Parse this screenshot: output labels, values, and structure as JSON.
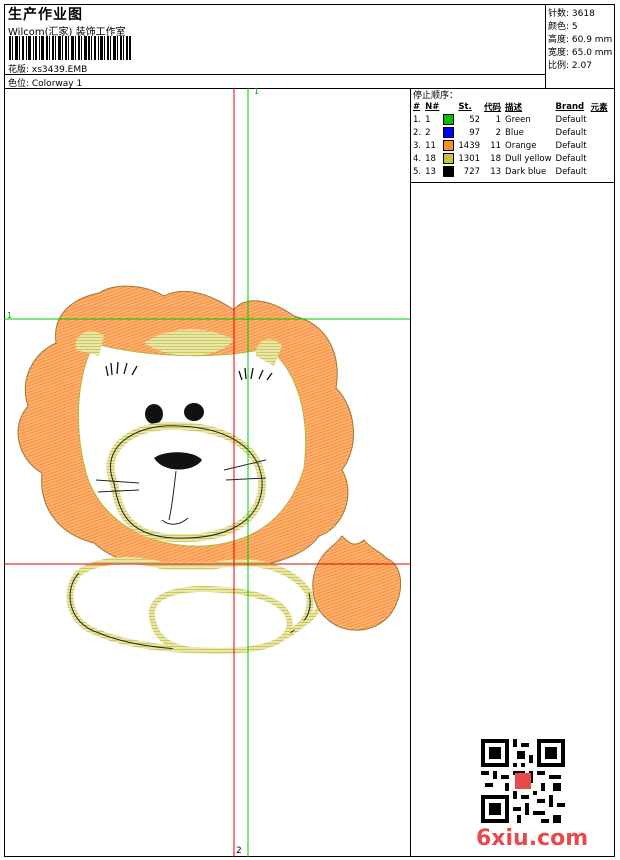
{
  "header": {
    "title": "生产作业图",
    "subtitle": "Wilcom(汇家) 装饰工作室",
    "design_label": "花版: xs3439.EMB",
    "colorway_label": "色位: Colorway 1"
  },
  "stats": {
    "stitches": "针数: 3618",
    "colors": "颜色: 5",
    "height": "高度: 60.9 mm",
    "width": "宽度: 65.0 mm",
    "scale": "比例: 2.07"
  },
  "stop_sequence": {
    "title": "停止顺序：",
    "headers": [
      "#",
      "N#",
      "St.",
      "代码",
      "描述",
      "Brand",
      "元素"
    ],
    "rows": [
      {
        "idx": "1.",
        "n": "1",
        "color": "#00c000",
        "st": "52",
        "code": "1",
        "desc": "Green",
        "brand": "Default"
      },
      {
        "idx": "2.",
        "n": "2",
        "color": "#0000ff",
        "st": "97",
        "code": "2",
        "desc": "Blue",
        "brand": "Default"
      },
      {
        "idx": "3.",
        "n": "11",
        "color": "#ff8c2a",
        "st": "1439",
        "code": "11",
        "desc": "Orange",
        "brand": "Default"
      },
      {
        "idx": "4.",
        "n": "18",
        "color": "#c9c23a",
        "st": "1301",
        "code": "18",
        "desc": "Dull yellow",
        "brand": "Default"
      },
      {
        "idx": "5.",
        "n": "13",
        "color": "#000000",
        "st": "727",
        "code": "13",
        "desc": "Dark blue",
        "brand": "Default"
      }
    ]
  },
  "guides": {
    "top_label": "1",
    "left_label": "1",
    "bottom_label": "2",
    "red": "#e00000",
    "green": "#00c800"
  },
  "watermark": {
    "site": "6xiu.com"
  },
  "icons": {
    "barcode": "barcode-icon",
    "qr": "qr-code-icon"
  }
}
